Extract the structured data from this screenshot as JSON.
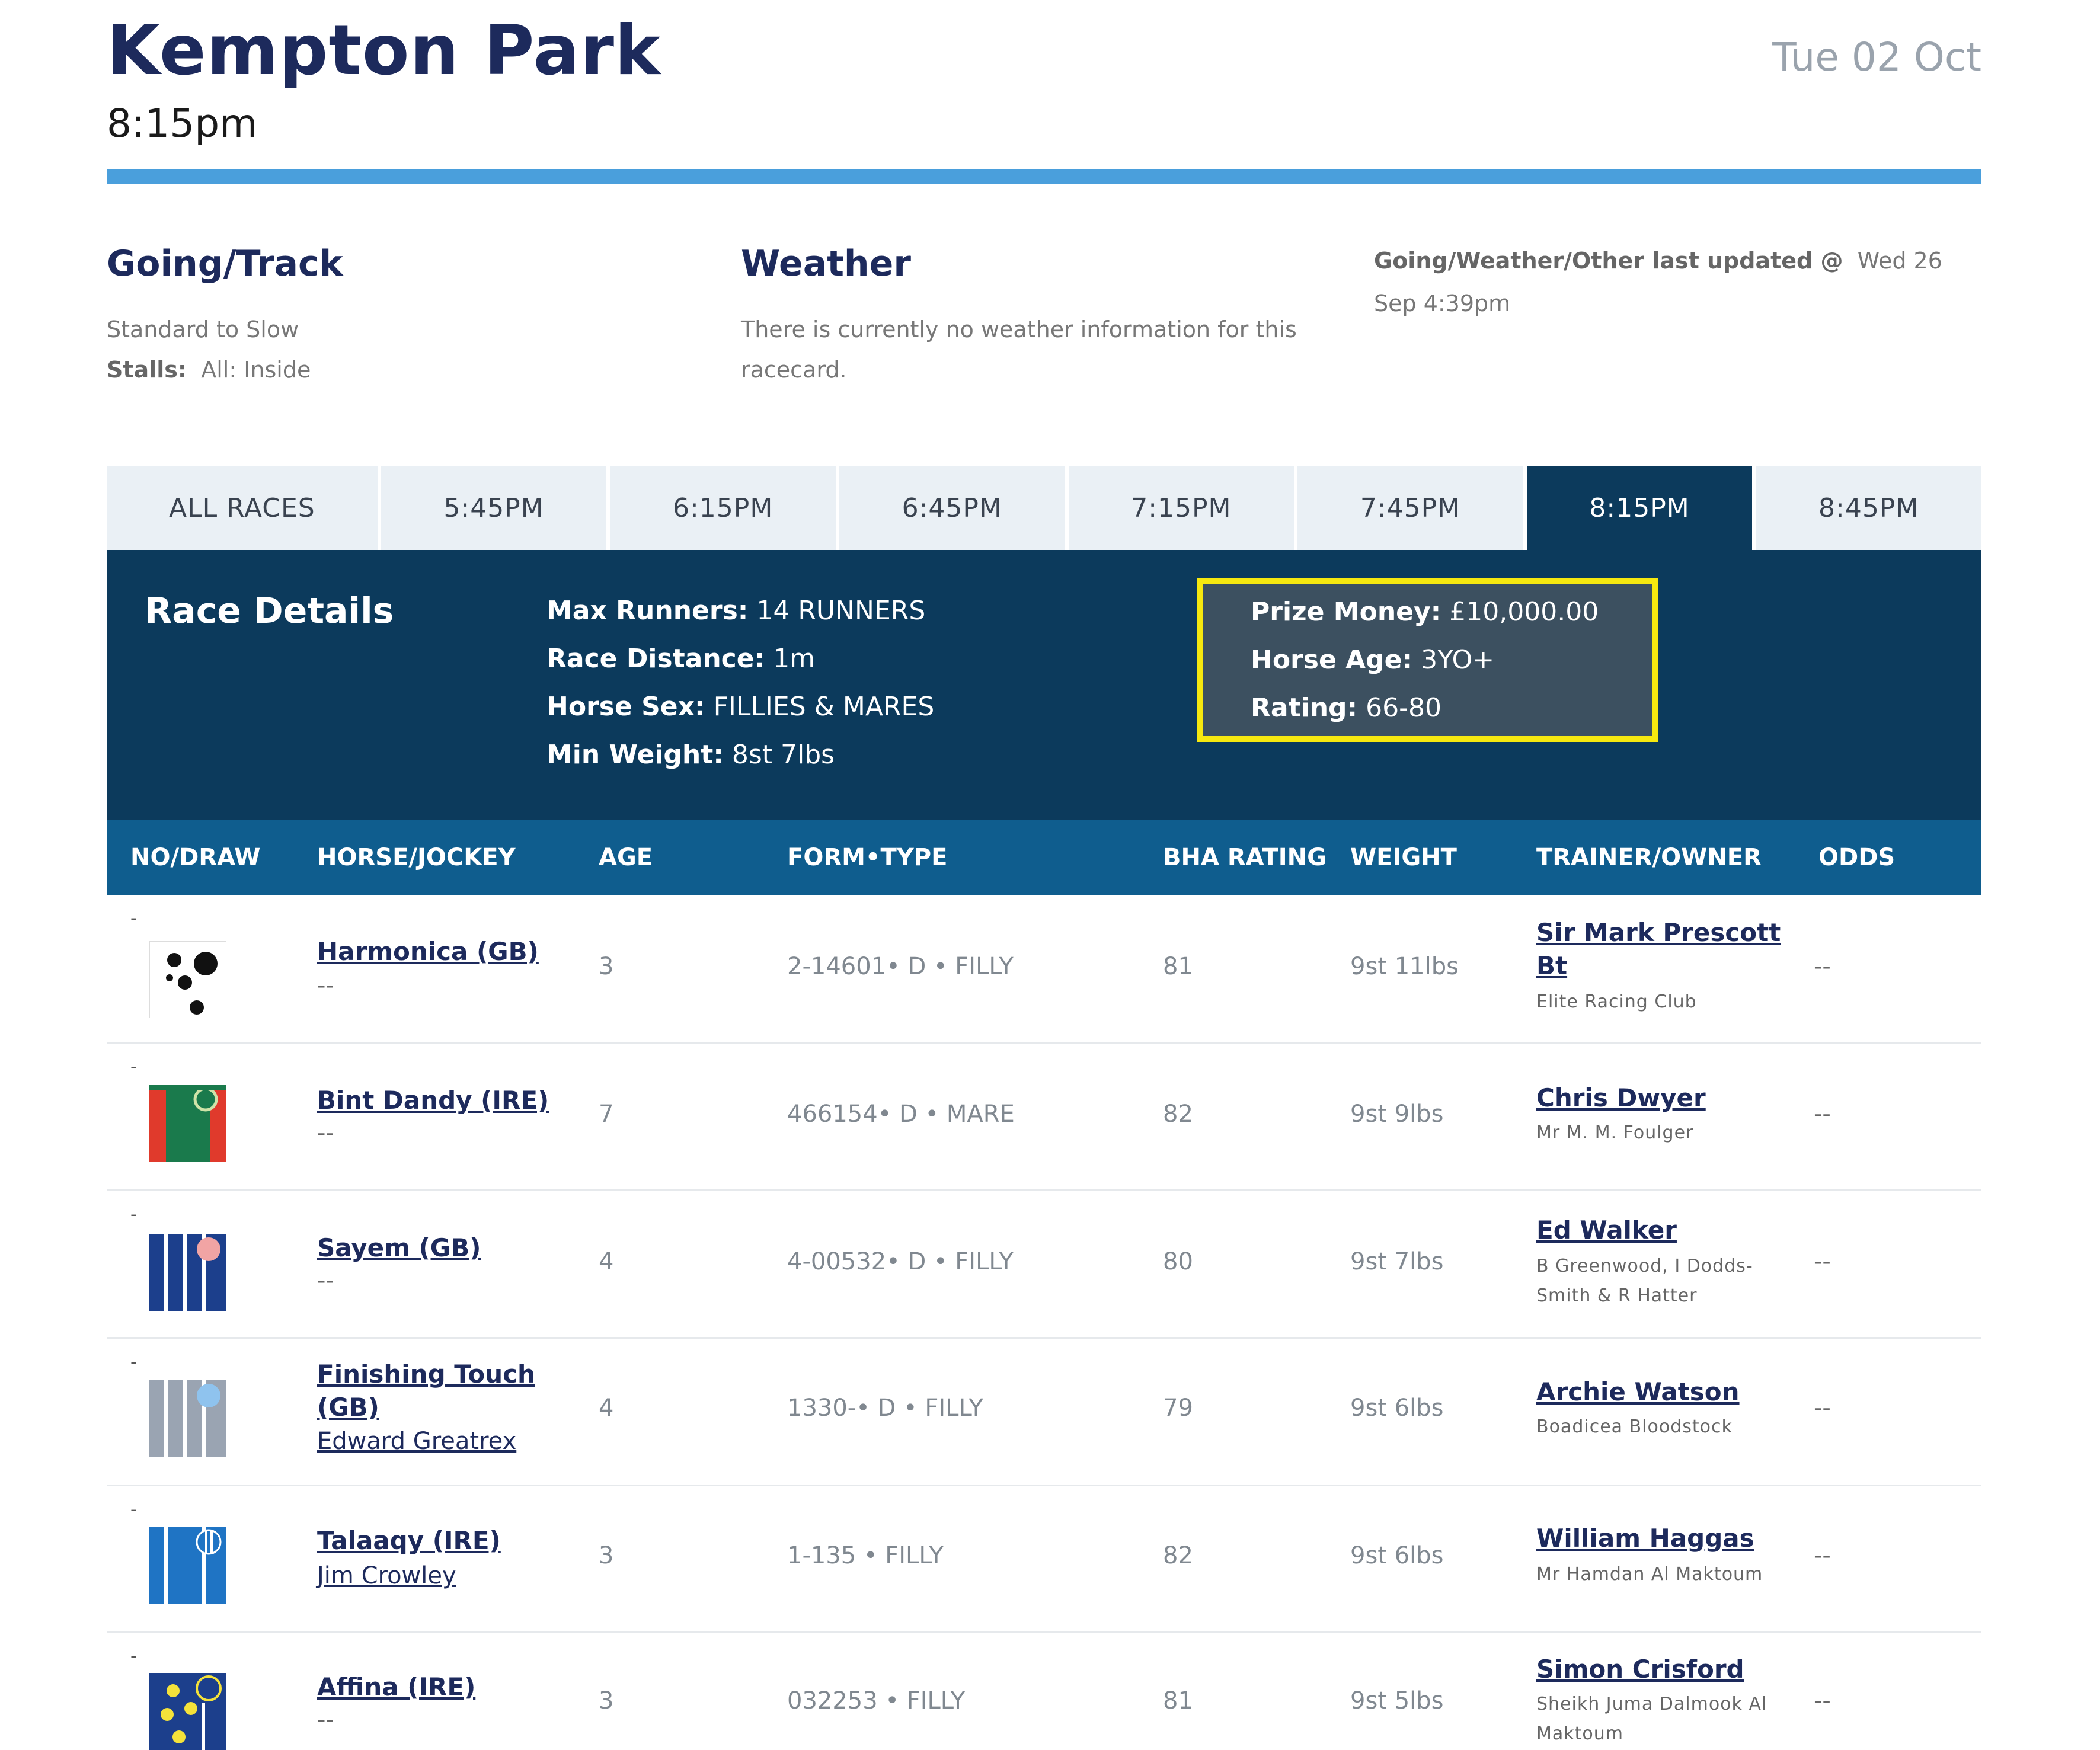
{
  "header": {
    "venue": "Kempton Park",
    "race_time": "8:15pm",
    "date": "Tue 02 Oct"
  },
  "going": {
    "heading": "Going/Track",
    "value": "Standard to Slow",
    "stalls_label": "Stalls:",
    "stalls_value": "All: Inside"
  },
  "weather": {
    "heading": "Weather",
    "text": "There is currently no weather information for this racecard."
  },
  "updated": {
    "label": "Going/Weather/Other last updated @",
    "value": "Wed 26 Sep 4:39pm"
  },
  "tabs": [
    {
      "label": "ALL RACES",
      "active": false
    },
    {
      "label": "5:45PM",
      "active": false
    },
    {
      "label": "6:15PM",
      "active": false
    },
    {
      "label": "6:45PM",
      "active": false
    },
    {
      "label": "7:15PM",
      "active": false
    },
    {
      "label": "7:45PM",
      "active": false
    },
    {
      "label": "8:15PM",
      "active": true
    },
    {
      "label": "8:45PM",
      "active": false
    }
  ],
  "race_details": {
    "title": "Race Details",
    "max_runners_label": "Max Runners:",
    "max_runners": "14 RUNNERS",
    "distance_label": "Race Distance:",
    "distance": "1m",
    "sex_label": "Horse Sex:",
    "sex": "FILLIES & MARES",
    "min_weight_label": "Min Weight:",
    "min_weight": "8st 7lbs",
    "prize_label": "Prize Money:",
    "prize": "£10,000.00",
    "age_label": "Horse Age:",
    "age": "3YO+",
    "rating_label": "Rating:",
    "rating": "66-80"
  },
  "columns": {
    "no_draw": "NO/DRAW",
    "horse_jockey": "HORSE/JOCKEY",
    "age": "AGE",
    "form_type": "FORM•TYPE",
    "bha": "BHA RATING",
    "weight": "WEIGHT",
    "trainer_owner": "TRAINER/OWNER",
    "odds": "ODDS"
  },
  "runners": [
    {
      "draw": "-",
      "horse": "Harmonica (GB)",
      "jockey": "--",
      "age": "3",
      "form": "2-14601• D • FILLY",
      "bha": "81",
      "weight": "9st 11lbs",
      "trainer": "Sir Mark Prescott Bt",
      "owner": "Elite Racing Club",
      "odds": "--"
    },
    {
      "draw": "-",
      "horse": "Bint Dandy (IRE)",
      "jockey": "--",
      "age": "7",
      "form": "466154• D • MARE",
      "bha": "82",
      "weight": "9st 9lbs",
      "trainer": "Chris Dwyer",
      "owner": "Mr M. M. Foulger",
      "odds": "--"
    },
    {
      "draw": "-",
      "horse": "Sayem (GB)",
      "jockey": "--",
      "age": "4",
      "form": "4-00532• D • FILLY",
      "bha": "80",
      "weight": "9st 7lbs",
      "trainer": "Ed Walker",
      "owner": "B Greenwood, I Dodds-Smith & R Hatter",
      "odds": "--"
    },
    {
      "draw": "-",
      "horse": "Finishing Touch (GB)",
      "jockey": "Edward Greatrex",
      "age": "4",
      "form": "1330-• D • FILLY",
      "bha": "79",
      "weight": "9st 6lbs",
      "trainer": "Archie Watson",
      "owner": "Boadicea Bloodstock",
      "odds": "--"
    },
    {
      "draw": "-",
      "horse": "Talaaqy (IRE)",
      "jockey": "Jim Crowley",
      "age": "3",
      "form": "1-135 • FILLY",
      "bha": "82",
      "weight": "9st 6lbs",
      "trainer": "William Haggas",
      "owner": "Mr Hamdan Al Maktoum",
      "odds": "--"
    },
    {
      "draw": "-",
      "horse": "Affina (IRE)",
      "jockey": "--",
      "age": "3",
      "form": "032253 • FILLY",
      "bha": "81",
      "weight": "9st 5lbs",
      "trainer": "Simon Crisford",
      "owner": "Sheikh Juma Dalmook Al Maktoum",
      "odds": "--"
    }
  ]
}
